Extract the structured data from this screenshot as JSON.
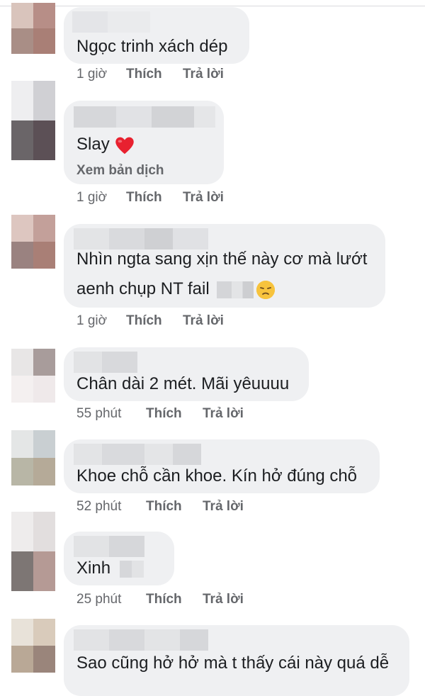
{
  "comments": [
    {
      "text": "Ngọc trinh xách dép",
      "time": "1 giờ",
      "like": "Thích",
      "reply": "Trả lời"
    },
    {
      "text": "Slay",
      "translate": "Xem bản dịch",
      "time": "1 giờ",
      "like": "Thích",
      "reply": "Trả lời"
    },
    {
      "text_line1": "Nhìn ngta sang xịn thế này cơ mà lướt",
      "text_line2": "aenh chụp NT fail",
      "time": "1 giờ",
      "like": "Thích",
      "reply": "Trả lời"
    },
    {
      "text": "Chân dài 2 mét. Mãi yêuuuu",
      "time": "55 phút",
      "like": "Thích",
      "reply": "Trả lời"
    },
    {
      "text": "Khoe chỗ cần khoe. Kín hở đúng chỗ",
      "time": "52 phút",
      "like": "Thích",
      "reply": "Trả lời"
    },
    {
      "text": "Xinh",
      "time": "25 phút",
      "like": "Thích",
      "reply": "Trả lời"
    },
    {
      "text": "Sao cũng hở hở mà t thấy cái này quá dễ"
    }
  ],
  "colors": {
    "bubble": "#eff0f2",
    "meta": "#65676b",
    "text": "#1c1e21",
    "heart": "#e8212f",
    "emoji": "#f7c33d"
  },
  "icons": [
    "heart-emoji-icon",
    "disappointed-face-emoji-icon"
  ]
}
